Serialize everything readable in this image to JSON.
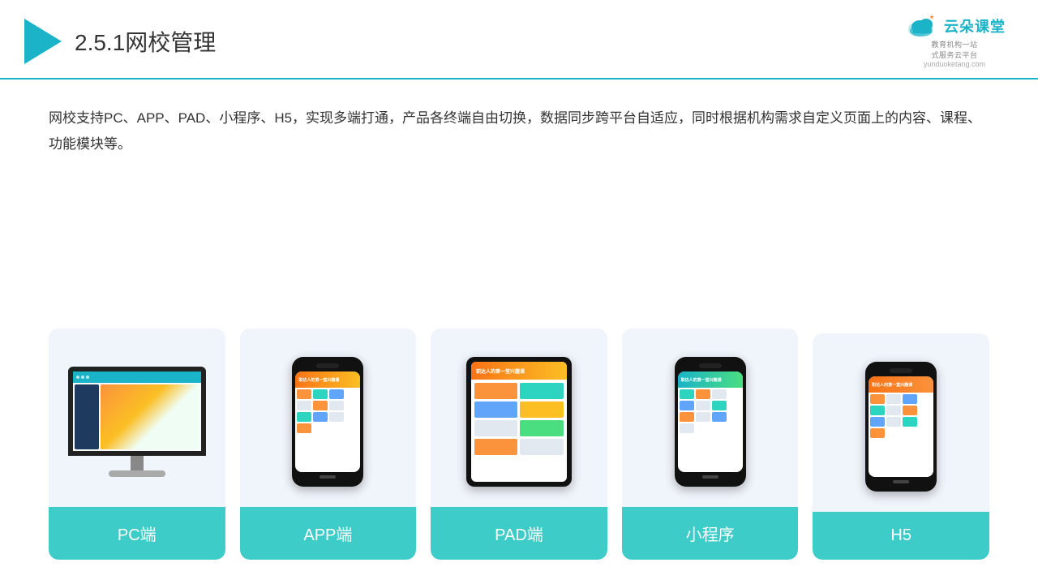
{
  "header": {
    "title_number": "2.5.1",
    "title_text": "网校管理",
    "logo_main": "云朵课堂",
    "logo_sub": "教育机构一站\n式服务云平台",
    "logo_url": "yunduoketang.com"
  },
  "description": {
    "text": "网校支持PC、APP、PAD、小程序、H5，实现多端打通，产品各终端自由切换，数据同步跨平台自适应，同时根据机构需求自定义页面上的内容、课程、功能模块等。"
  },
  "cards": [
    {
      "id": "pc",
      "label": "PC端"
    },
    {
      "id": "app",
      "label": "APP端"
    },
    {
      "id": "pad",
      "label": "PAD端"
    },
    {
      "id": "miniapp",
      "label": "小程序"
    },
    {
      "id": "h5",
      "label": "H5"
    }
  ],
  "colors": {
    "accent": "#1ab3c8",
    "card_bg": "#f0f4fb",
    "card_label_bg": "#3eccc8",
    "header_border": "#1ab3c8"
  }
}
